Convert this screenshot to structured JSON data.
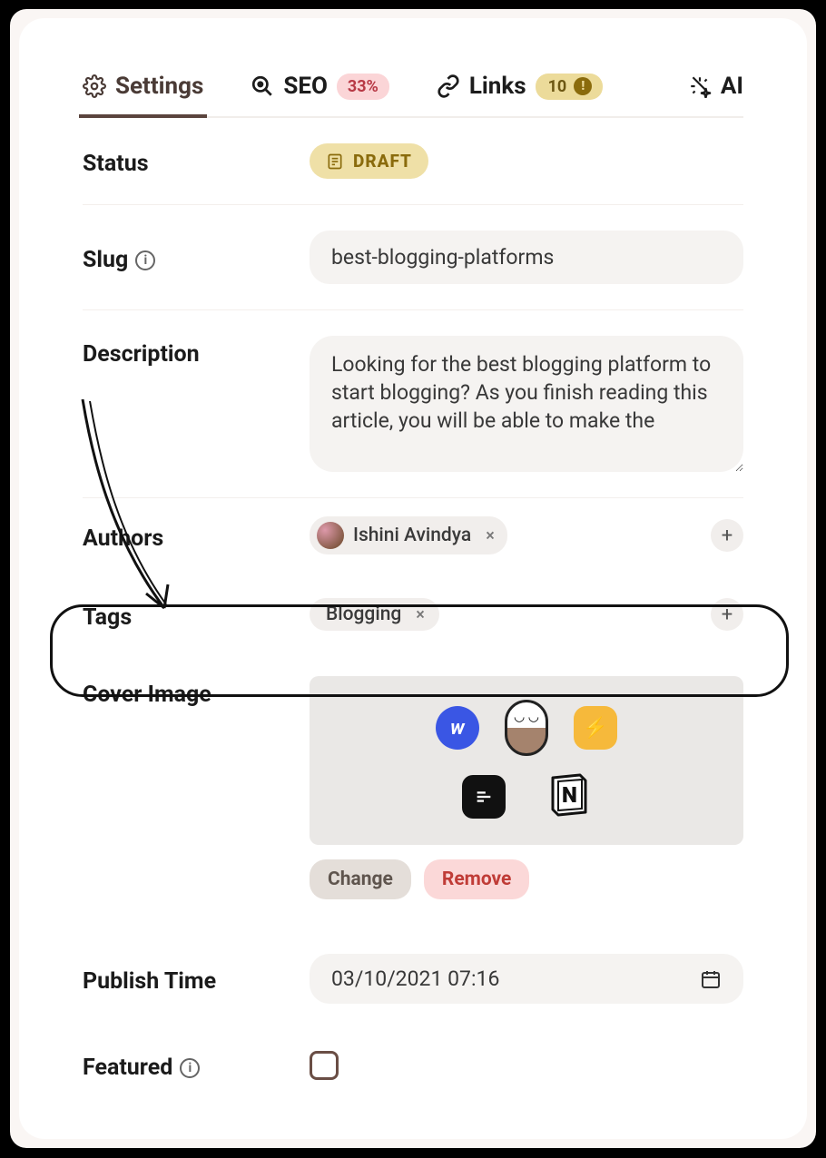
{
  "tabs": {
    "settings": "Settings",
    "seo": "SEO",
    "seo_badge": "33%",
    "links": "Links",
    "links_count": "10",
    "links_alert": "!",
    "ai": "AI"
  },
  "fields": {
    "status_label": "Status",
    "status_value": "DRAFT",
    "slug_label": "Slug",
    "slug_value": "best-blogging-platforms",
    "description_label": "Description",
    "description_value": "Looking for the best blogging platform to start blogging? As you finish reading this article, you will be able to make the",
    "authors_label": "Authors",
    "author_name": "Ishini Avindya",
    "tags_label": "Tags",
    "tag_value": "Blogging",
    "cover_label": "Cover Image",
    "change_btn": "Change",
    "remove_btn": "Remove",
    "publish_label": "Publish Time",
    "publish_value": "03/10/2021 07:16",
    "featured_label": "Featured"
  }
}
